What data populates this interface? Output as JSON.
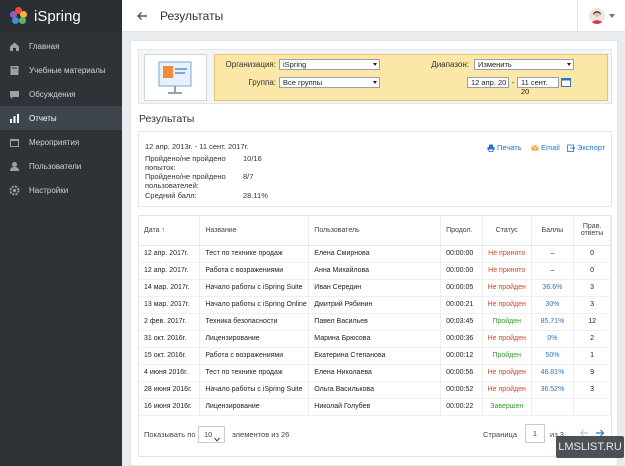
{
  "app": {
    "name": "iSpring"
  },
  "sidebar": {
    "items": [
      {
        "label": "Главная",
        "icon": "home-icon",
        "active": false
      },
      {
        "label": "Учебные материалы",
        "icon": "book-icon",
        "active": false
      },
      {
        "label": "Обсуждения",
        "icon": "chat-icon",
        "active": false
      },
      {
        "label": "Отчеты",
        "icon": "bar-chart-icon",
        "active": true
      },
      {
        "label": "Мероприятия",
        "icon": "calendar-icon",
        "active": false
      },
      {
        "label": "Пользователи",
        "icon": "user-icon",
        "active": false
      },
      {
        "label": "Настройки",
        "icon": "gear-icon",
        "active": false
      }
    ]
  },
  "header": {
    "title": "Результаты"
  },
  "filter": {
    "org_label": "Организация:",
    "org_value": "iSpring",
    "group_label": "Группа:",
    "group_value": "Все группы",
    "range_label": "Диапазон:",
    "range_value": "Изменить",
    "date_from": "12 апр. 20",
    "date_sep": "-",
    "date_to": "11 сент. 20"
  },
  "results": {
    "title": "Результаты",
    "period": "12 апр. 2013г. - 11 сент. 2017г.",
    "passed_attempts_label": "Пройдено/не пройдено попыток:",
    "passed_attempts_value": "10/16",
    "passed_users_label": "Пройдено/не пройдено пользователей:",
    "passed_users_value": "8/7",
    "avg_label": "Средний балл:",
    "avg_value": "28.11%",
    "print": "Печать",
    "email": "Email",
    "export": "Экспорт"
  },
  "table": {
    "headers": [
      "Дата ↑",
      "Название",
      "Пользователь",
      "Продол.",
      "Статус",
      "Баллы",
      "Прав. ответы"
    ],
    "rows": [
      [
        "12 апр. 2017г.",
        "Тест по технике продаж",
        "Елена Смирнова",
        "00:00:00",
        "Не принято",
        "–",
        "0"
      ],
      [
        "12 апр. 2017г.",
        "Работа с возражениями",
        "Анна Михайлова",
        "00:00:00",
        "Не принято",
        "–",
        "0"
      ],
      [
        "14 мар. 2017г.",
        "Начало работы с iSpring Suite",
        "Иван Середин",
        "00:00:05",
        "Не пройден",
        "36.6%",
        "3"
      ],
      [
        "13 мар. 2017г.",
        "Начало работы с iSpring Online",
        "Дмитрий Рябинин",
        "00:00:21",
        "Не пройден",
        "30%",
        "3"
      ],
      [
        "2 фев. 2017г.",
        "Техника безопасности",
        "Павел Васильев",
        "00:03:45",
        "Пройден",
        "85.71%",
        "12"
      ],
      [
        "31 окт. 2016г.",
        "Лицензирование",
        "Марина Брюсова",
        "00:00:36",
        "Не пройден",
        "0%",
        "2"
      ],
      [
        "15 окт. 2016г.",
        "Работа с возражениями",
        "Екатерина Степанова",
        "00:00:12",
        "Пройден",
        "50%",
        "1"
      ],
      [
        "4 июня 2016г.",
        "Тест по технике продаж",
        "Елена Николаева",
        "00:00:56",
        "Не пройден",
        "46.81%",
        "9"
      ],
      [
        "28 июня 2016г.",
        "Начало работы с iSpring Suite",
        "Ольга Васильковa",
        "00:00:52",
        "Не пройден",
        "36.52%",
        "3"
      ],
      [
        "16 июня 2016г.",
        "Лицензирование",
        "Николай Голубев",
        "00:00:22",
        "Завершен",
        "",
        ""
      ]
    ]
  },
  "pager": {
    "show_label": "Показывать по",
    "per_page": "10",
    "of_label": "элементов из 26",
    "page_label": "Страница",
    "page": "1",
    "of_pages": "из 3"
  },
  "watermark": "LMSLIST.RU",
  "colors": {
    "sidebar": "#2e3338",
    "accent": "#2a74c9",
    "fail": "#d4442b",
    "pass": "#3a9a35",
    "filter": "#fbe7a8"
  }
}
